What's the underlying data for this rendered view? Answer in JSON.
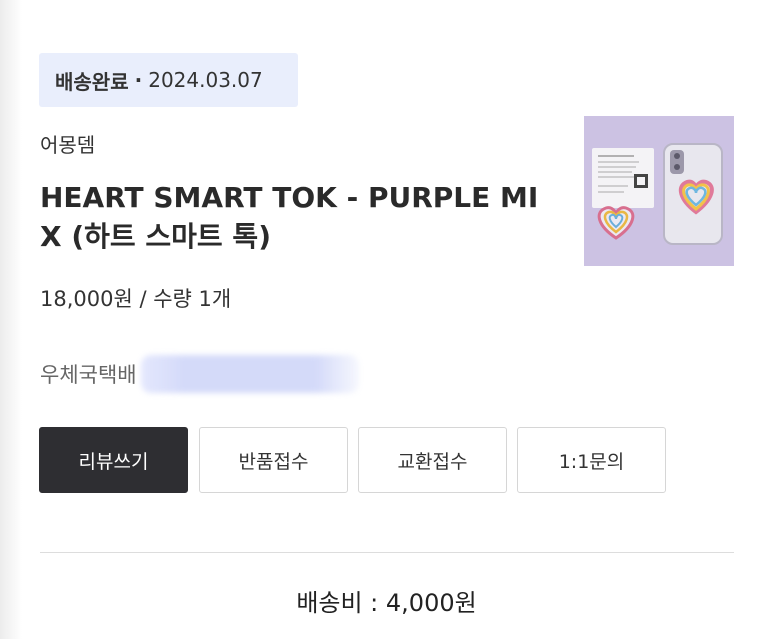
{
  "order": {
    "status": "배송완료",
    "separator": "·",
    "date": "2024.03.07"
  },
  "product": {
    "store": "어몽뎀",
    "title": "HEART SMART TOK - PURPLE MIX (하트 스마트 톡)",
    "price_qty": "18,000원 / 수량 1개",
    "image_icon": "product-photo-heart-phone-grip"
  },
  "delivery": {
    "courier": "우체국택배"
  },
  "actions": {
    "review": "리뷰쓰기",
    "return": "반품접수",
    "exchange": "교환접수",
    "inquiry": "1:1문의"
  },
  "shipping": {
    "fee_text": "배송비 : 4,000원"
  },
  "colors": {
    "badge_bg": "#e9eefc",
    "primary_button": "#2e2e32",
    "image_bg": "#c9bedf"
  }
}
